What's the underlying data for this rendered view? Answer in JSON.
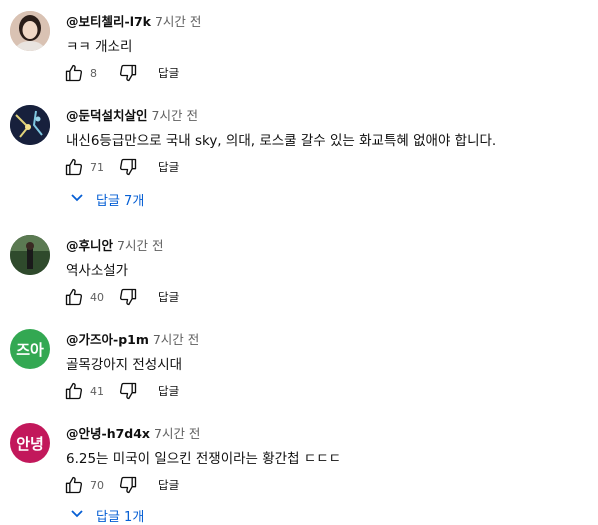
{
  "comments": [
    {
      "author": "@보티첼리-l7k",
      "time": "7시간 전",
      "text": "ㅋㅋ 개소리",
      "likes": "8",
      "reply_label": "답글",
      "avatar": {
        "type": "photo",
        "color": "#c8a894"
      }
    },
    {
      "author": "@둔덕설치살인",
      "time": "7시간 전",
      "text": "내신6등급만으로 국내 sky, 의대, 로스쿨 갈수 있는 화교특혜 없애야 합니다.",
      "likes": "71",
      "reply_label": "답글",
      "replies_label": "답글 7개",
      "avatar": {
        "type": "photo",
        "color": "#1e2a4a"
      }
    },
    {
      "author": "@후니안",
      "time": "7시간 전",
      "text": "역사소설가",
      "likes": "40",
      "reply_label": "답글",
      "avatar": {
        "type": "photo",
        "color": "#3c5a38"
      }
    },
    {
      "author": "@가즈아-p1m",
      "time": "7시간 전",
      "text": "골목강아지 전성시대",
      "likes": "41",
      "reply_label": "답글",
      "avatar": {
        "type": "text",
        "label": "즈아",
        "color": "#33a852"
      }
    },
    {
      "author": "@안녕-h7d4x",
      "time": "7시간 전",
      "text": "6.25는 미국이 일으킨 전쟁이라는 황간첩 ㄷㄷㄷ",
      "likes": "70",
      "reply_label": "답글",
      "replies_label": "답글 1개",
      "avatar": {
        "type": "text",
        "label": "안녕",
        "color": "#c2185b"
      }
    }
  ],
  "icons": {
    "like": "thumbs-up-icon",
    "dislike": "thumbs-down-icon",
    "expand": "chevron-down-icon"
  },
  "colors": {
    "link": "#065fd4",
    "meta": "#606060"
  }
}
